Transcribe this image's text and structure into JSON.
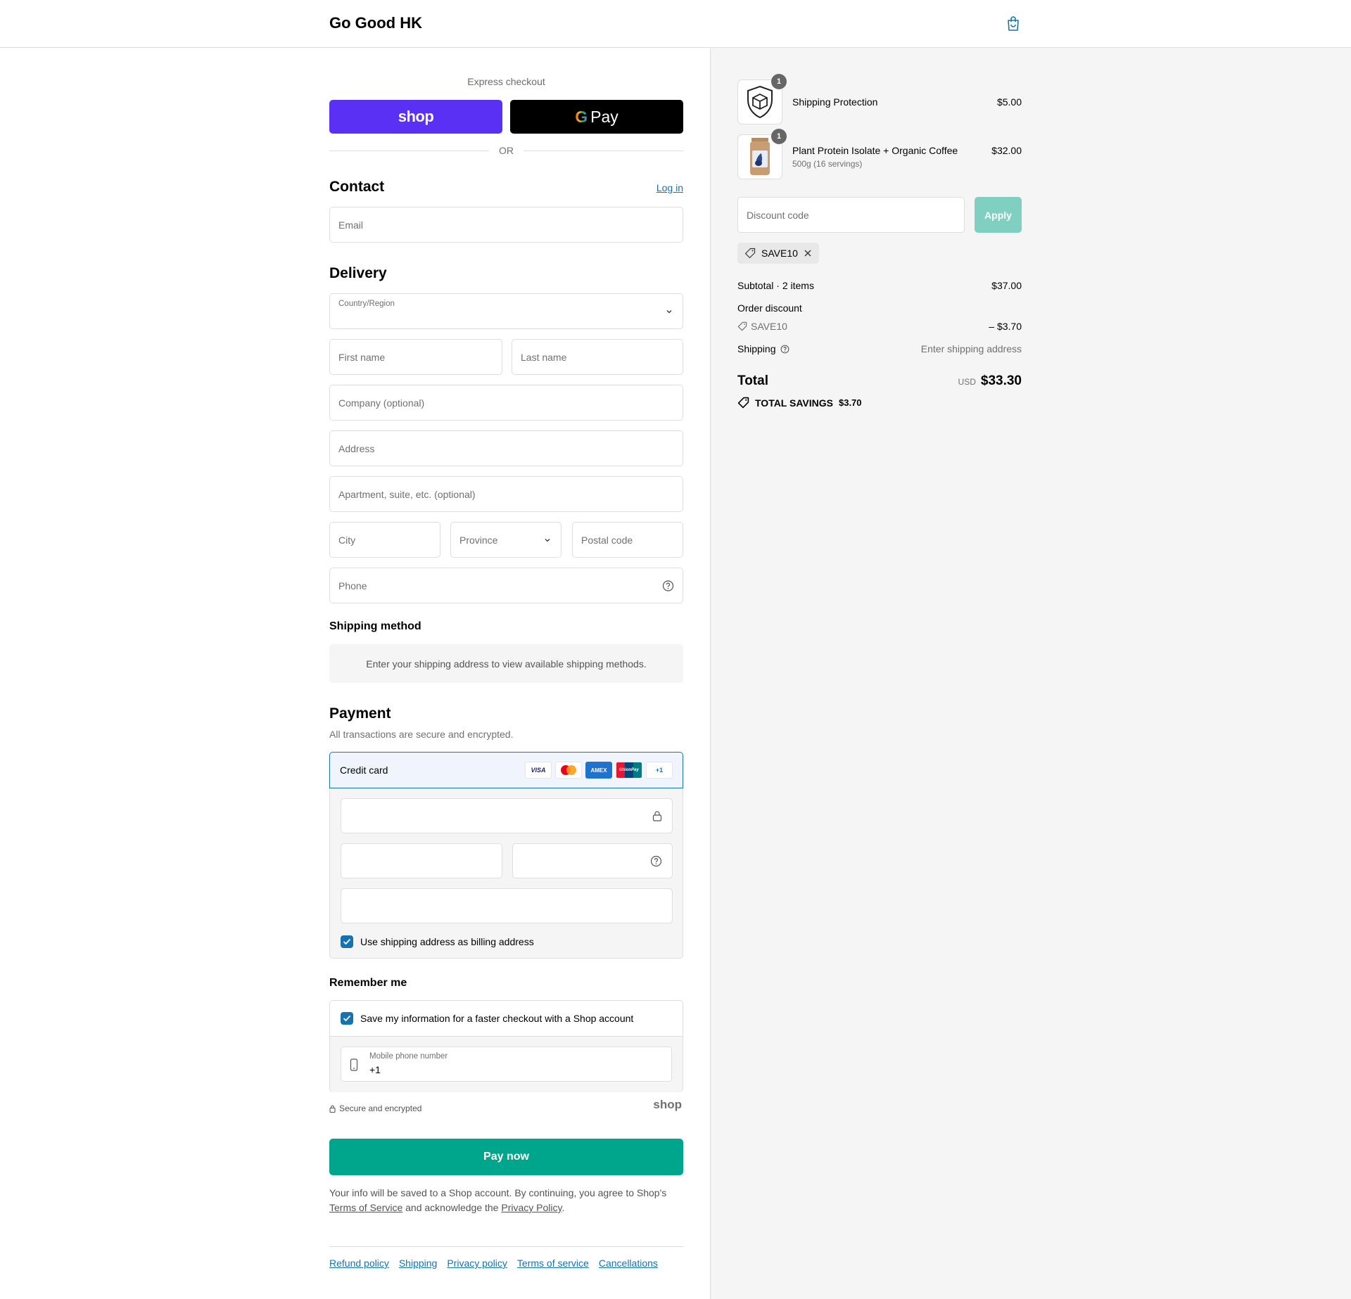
{
  "header": {
    "brand": "Go Good HK"
  },
  "express": {
    "title": "Express checkout",
    "shop_label": "shop",
    "gpay_label": "Pay",
    "or": "OR"
  },
  "contact": {
    "title": "Contact",
    "login": "Log in",
    "email_placeholder": "Email"
  },
  "delivery": {
    "title": "Delivery",
    "country_label": "Country/Region",
    "first_name": "First name",
    "last_name": "Last name",
    "company": "Company (optional)",
    "address": "Address",
    "apartment": "Apartment, suite, etc. (optional)",
    "city": "City",
    "province": "Province",
    "postal": "Postal code",
    "phone": "Phone"
  },
  "shipping_method": {
    "title": "Shipping method",
    "message": "Enter your shipping address to view available shipping methods."
  },
  "payment": {
    "title": "Payment",
    "subtitle": "All transactions are secure and encrypted.",
    "credit_card": "Credit card",
    "card_logos": [
      "VISA",
      "MC",
      "AMEX",
      "UnionPay",
      "+1"
    ],
    "billing_same": "Use shipping address as billing address"
  },
  "remember": {
    "title": "Remember me",
    "save_info": "Save my information for a faster checkout with a Shop account",
    "mobile_label": "Mobile phone number",
    "mobile_value": "+1",
    "secure": "Secure and encrypted",
    "shop_brand": "shop"
  },
  "pay_now": "Pay now",
  "legal": {
    "line1": "Your info will be saved to a Shop account. By continuing, you agree to Shop's",
    "tos": "Terms of Service",
    "mid": "and acknowledge the",
    "privacy": "Privacy Policy",
    "end": "."
  },
  "footer": {
    "links": [
      "Refund policy",
      "Shipping",
      "Privacy policy",
      "Terms of service",
      "Cancellations"
    ]
  },
  "summary": {
    "items": [
      {
        "name": "Shipping Protection",
        "variant": "",
        "price": "$5.00",
        "qty": "1",
        "icon": "shield-box-icon"
      },
      {
        "name": "Plant Protein Isolate + Organic Coffee",
        "variant": "500g (16 servings)",
        "price": "$32.00",
        "qty": "1",
        "icon": "product-jar"
      }
    ],
    "discount_placeholder": "Discount code",
    "apply": "Apply",
    "applied_code": "SAVE10",
    "subtotal_label": "Subtotal · 2 items",
    "subtotal_value": "$37.00",
    "order_discount_label": "Order discount",
    "discount_code": "SAVE10",
    "discount_value": "– $3.70",
    "shipping_label": "Shipping",
    "shipping_value": "Enter shipping address",
    "total_label": "Total",
    "currency": "USD",
    "total_value": "$33.30",
    "savings_label": "TOTAL SAVINGS",
    "savings_value": "$3.70"
  },
  "colors": {
    "accent": "#1773b0",
    "shop_purple": "#5a31f4",
    "pay_green": "#00a68b",
    "apply_disabled": "#7fd0c1"
  }
}
